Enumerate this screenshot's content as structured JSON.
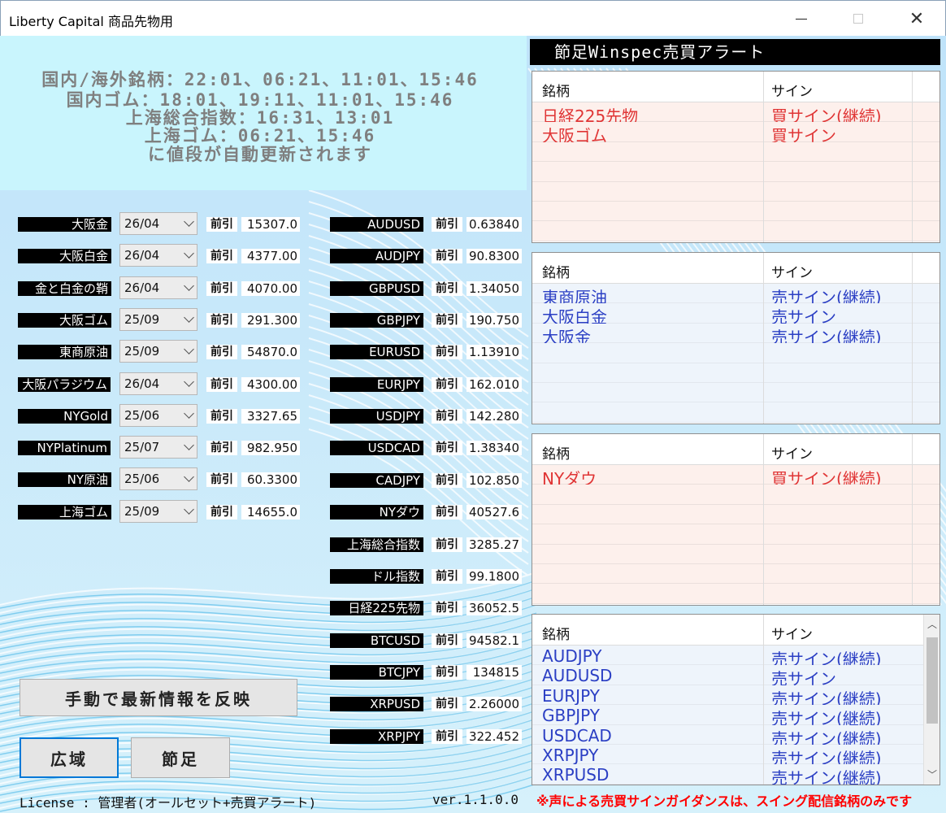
{
  "window": {
    "title": "Liberty Capital 商品先物用",
    "minimize_icon": "minimize-icon",
    "maximize_icon": "maximize-icon",
    "close_icon": "close-icon",
    "close_glyph": "✕"
  },
  "schedule": {
    "lines": [
      "国内/海外銘柄：22:01、06:21、11:01、15:46",
      "国内ゴム：18:01、19:11、11:01、15:46",
      "上海総合指数：16:31、13:01",
      "上海ゴム：06:21、15:46",
      "に値段が自動更新されます"
    ]
  },
  "left_items": [
    {
      "name": "大阪金",
      "month": "26/04",
      "label": "前引",
      "value": "15307.0"
    },
    {
      "name": "大阪白金",
      "month": "26/04",
      "label": "前引",
      "value": "4377.00"
    },
    {
      "name": "金と白金の鞘",
      "month": "26/04",
      "label": "前引",
      "value": "4070.00"
    },
    {
      "name": "大阪ゴム",
      "month": "25/09",
      "label": "前引",
      "value": "291.300"
    },
    {
      "name": "東商原油",
      "month": "25/09",
      "label": "前引",
      "value": "54870.0"
    },
    {
      "name": "大阪パラジウム",
      "month": "26/04",
      "label": "前引",
      "value": "4300.00"
    },
    {
      "name": "NYGold",
      "month": "25/06",
      "label": "前引",
      "value": "3327.65"
    },
    {
      "name": "NYPlatinum",
      "month": "25/07",
      "label": "前引",
      "value": "982.950"
    },
    {
      "name": "NY原油",
      "month": "25/06",
      "label": "前引",
      "value": "60.3300"
    },
    {
      "name": "上海ゴム",
      "month": "25/09",
      "label": "前引",
      "value": "14655.0"
    }
  ],
  "right_items": [
    {
      "name": "AUDUSD",
      "label": "前引",
      "value": "0.63840"
    },
    {
      "name": "AUDJPY",
      "label": "前引",
      "value": "90.8300"
    },
    {
      "name": "GBPUSD",
      "label": "前引",
      "value": "1.34050"
    },
    {
      "name": "GBPJPY",
      "label": "前引",
      "value": "190.750"
    },
    {
      "name": "EURUSD",
      "label": "前引",
      "value": "1.13910"
    },
    {
      "name": "EURJPY",
      "label": "前引",
      "value": "162.010"
    },
    {
      "name": "USDJPY",
      "label": "前引",
      "value": "142.280"
    },
    {
      "name": "USDCAD",
      "label": "前引",
      "value": "1.38340"
    },
    {
      "name": "CADJPY",
      "label": "前引",
      "value": "102.850"
    },
    {
      "name": "NYダウ",
      "label": "前引",
      "value": "40527.6"
    },
    {
      "name": "上海総合指数",
      "label": "前引",
      "value": "3285.27"
    },
    {
      "name": "ドル指数",
      "label": "前引",
      "value": "99.1800"
    },
    {
      "name": "日経225先物",
      "label": "前引",
      "value": "36052.5"
    },
    {
      "name": "BTCUSD",
      "label": "前引",
      "value": "94582.1"
    },
    {
      "name": "BTCJPY",
      "label": "前引",
      "value": "134815"
    },
    {
      "name": "XRPUSD",
      "label": "前引",
      "value": "2.26000"
    },
    {
      "name": "XRPJPY",
      "label": "前引",
      "value": "322.452"
    }
  ],
  "buttons": {
    "manual_update": "手動で最新情報を反映",
    "wide": "広域",
    "setsuashi": "節足"
  },
  "alert": {
    "title": "節足Winspec売買アラート",
    "col_symbol": "銘柄",
    "col_sign": "サイン",
    "grids": [
      {
        "theme": "pink",
        "rows": [
          {
            "symbol": "日経225先物",
            "sign": "買サイン(継続)",
            "color": "#e03535"
          },
          {
            "symbol": "大阪ゴム",
            "sign": "買サイン",
            "color": "#e03535"
          }
        ]
      },
      {
        "theme": "blue",
        "rows": [
          {
            "symbol": "東商原油",
            "sign": "売サイン(継続)",
            "color": "#2b3fc4"
          },
          {
            "symbol": "大阪白金",
            "sign": "売サイン",
            "color": "#2b3fc4"
          },
          {
            "symbol": "大阪金",
            "sign": "売サイン(継続)",
            "color": "#2b3fc4"
          }
        ]
      },
      {
        "theme": "pink",
        "rows": [
          {
            "symbol": "NYダウ",
            "sign": "買サイン(継続)",
            "color": "#e03535"
          }
        ]
      },
      {
        "theme": "blue",
        "rows": [
          {
            "symbol": "AUDJPY",
            "sign": "売サイン(継続)",
            "color": "#2b3fc4"
          },
          {
            "symbol": "AUDUSD",
            "sign": "売サイン",
            "color": "#2b3fc4"
          },
          {
            "symbol": "EURJPY",
            "sign": "売サイン(継続)",
            "color": "#2b3fc4"
          },
          {
            "symbol": "GBPJPY",
            "sign": "売サイン(継続)",
            "color": "#2b3fc4"
          },
          {
            "symbol": "USDCAD",
            "sign": "売サイン(継続)",
            "color": "#2b3fc4"
          },
          {
            "symbol": "XRPJPY",
            "sign": "売サイン(継続)",
            "color": "#2b3fc4"
          },
          {
            "symbol": "XRPUSD",
            "sign": "売サイン(継続)",
            "color": "#2b3fc4"
          }
        ]
      }
    ],
    "scroll_up_glyph": "︿",
    "scroll_down_glyph": "﹀"
  },
  "footer": {
    "license": "License : 管理者(オールセット+売買アラート)",
    "version": "ver.1.1.0.0",
    "note": "※声による売買サインガイダンスは、スイング配信銘柄のみです"
  }
}
